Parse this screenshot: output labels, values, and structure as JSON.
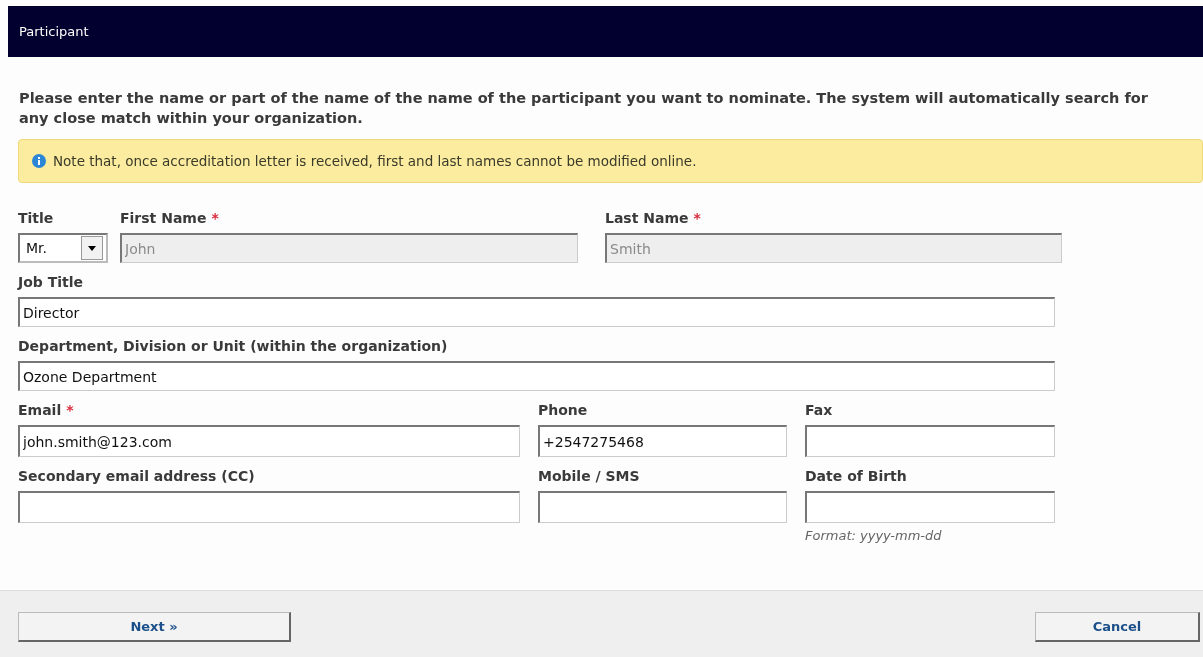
{
  "header": {
    "title": "Participant"
  },
  "intro": "Please enter the name or part of the name of the name of the participant you want to nominate. The system will automatically search for any close match within your organization.",
  "notice": "Note that, once accreditation letter is received, first and last names cannot be modified online.",
  "required_mark": "*",
  "rows": [
    [
      {
        "kind": "select",
        "label": "Title",
        "required": false,
        "value": "Mr."
      },
      {
        "kind": "text",
        "label": "First Name",
        "required": true,
        "value": "John",
        "disabled": true
      },
      {
        "kind": "text",
        "label": "Last Name",
        "required": true,
        "value": "Smith",
        "disabled": true
      }
    ],
    [
      {
        "kind": "text",
        "label": "Job Title",
        "required": false,
        "value": "Director",
        "disabled": false
      }
    ],
    [
      {
        "kind": "text",
        "label": "Department, Division or Unit (within the organization)",
        "required": false,
        "value": "Ozone Department",
        "disabled": false
      }
    ],
    [
      {
        "kind": "text",
        "label": "Email",
        "required": true,
        "value": "john.smith@123.com",
        "disabled": false
      },
      {
        "kind": "text",
        "label": "Phone",
        "required": false,
        "value": "+2547275468",
        "disabled": false
      },
      {
        "kind": "text",
        "label": "Fax",
        "required": false,
        "disabled": false
      }
    ],
    [
      {
        "kind": "text",
        "label": "Secondary email address (CC)",
        "required": false,
        "disabled": false
      },
      {
        "kind": "text",
        "label": "Mobile / SMS",
        "required": false,
        "disabled": false
      },
      {
        "kind": "text",
        "label": "Date of Birth",
        "required": false,
        "disabled": false,
        "hint": "Format: yyyy-mm-dd"
      }
    ]
  ],
  "buttons": {
    "next": "Next »",
    "cancel": "Cancel"
  }
}
